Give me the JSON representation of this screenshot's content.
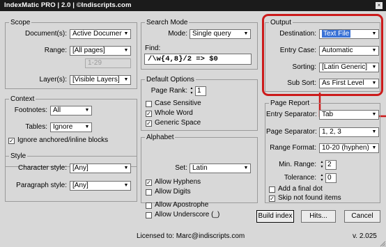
{
  "window": {
    "title": "IndexMatic PRO  |  2.0  |  ©Indiscripts.com",
    "close_glyph": "×"
  },
  "scope": {
    "title": "Scope",
    "documents_label": "Document(s):",
    "documents_value": "Active Document (i",
    "range_label": "Range:",
    "range_value": "[All pages]",
    "pages_value": "1-29",
    "layers_label": "Layer(s):",
    "layers_value": "[Visible Layers]"
  },
  "context": {
    "title": "Context",
    "footnotes_label": "Footnotes:",
    "footnotes_value": "All",
    "tables_label": "Tables:",
    "tables_value": "Ignore",
    "ignore_anchored_label": "Ignore anchored/inline blocks",
    "ignore_anchored_checked": true
  },
  "style": {
    "title": "Style",
    "character_label": "Character style:",
    "character_value": "[Any]",
    "paragraph_label": "Paragraph style:",
    "paragraph_value": "[Any]"
  },
  "search": {
    "title": "Search Mode",
    "mode_label": "Mode:",
    "mode_value": "Single query",
    "find_label": "Find:",
    "find_value": "/\\w{4,8}/2 => $0"
  },
  "default_options": {
    "title": "Default Options",
    "page_rank_label": "Page Rank:",
    "page_rank_value": "1",
    "case_sensitive_label": "Case Sensitive",
    "case_sensitive_checked": false,
    "whole_word_label": "Whole Word",
    "whole_word_checked": true,
    "generic_space_label": "Generic Space",
    "generic_space_checked": true
  },
  "alphabet": {
    "title": "Alphabet",
    "set_label": "Set:",
    "set_value": "Latin",
    "allow_hyphens_label": "Allow Hyphens",
    "allow_hyphens_checked": true,
    "allow_digits_label": "Allow Digits",
    "allow_digits_checked": false,
    "allow_apostrophe_label": "Allow Apostrophe",
    "allow_apostrophe_checked": false,
    "allow_underscore_label": "Allow Underscore (_)",
    "allow_underscore_checked": false
  },
  "output": {
    "title": "Output",
    "destination_label": "Destination:",
    "destination_value": "Text File",
    "entry_case_label": "Entry Case:",
    "entry_case_value": "Automatic",
    "sorting_label": "Sorting:",
    "sorting_value": "[Latin Generic]",
    "sub_sort_label": "Sub Sort:",
    "sub_sort_value": "As First Level"
  },
  "page_report": {
    "title": "Page Report",
    "entry_sep_label": "Entry Separator:",
    "entry_sep_value": "Tab",
    "page_sep_label": "Page Separator:",
    "page_sep_value": "1, 2, 3",
    "range_format_label": "Range Format:",
    "range_format_value": "10-20  (hyphen)",
    "min_range_label": "Min. Range:",
    "min_range_value": "2",
    "tolerance_label": "Tolerance:",
    "tolerance_value": "0",
    "final_dot_label": "Add a final dot",
    "final_dot_checked": false,
    "skip_not_found_label": "Skip not found items",
    "skip_not_found_checked": true
  },
  "buttons": {
    "build_index": "Build index",
    "hits": "Hits...",
    "cancel": "Cancel"
  },
  "footer": {
    "license": "Licensed to:  Marc@indiscripts.com",
    "version": "v. 2.025"
  },
  "icons": {
    "dropdown": "▼",
    "check": "✓",
    "spin_up": "▲",
    "spin_down": "▼"
  },
  "colors": {
    "highlight": "#3a72d6",
    "annotation": "#cc1a1a",
    "titlebar": "#1b1b1b"
  }
}
